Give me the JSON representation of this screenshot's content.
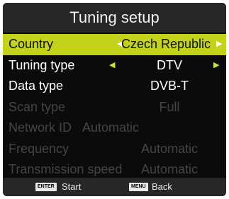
{
  "title": "Tuning setup",
  "rows": [
    {
      "label": "Country",
      "value": "Czech Republic",
      "arrow_left": "◀",
      "arrow_right": "▶"
    },
    {
      "label": "Tuning type",
      "value": "DTV",
      "arrow_left": "◀",
      "arrow_right": "▶"
    },
    {
      "label": "Data type",
      "value": "DVB-T"
    },
    {
      "label": "Scan type",
      "value": "Full"
    },
    {
      "label": "Network ID",
      "value": "Automatic"
    },
    {
      "label": "Frequency",
      "value": "Automatic"
    },
    {
      "label": "Transmission speed",
      "value": "Automatic"
    }
  ],
  "footer": {
    "enter_key": "ENTER",
    "enter_label": "Start",
    "menu_key": "MENU",
    "menu_label": "Back"
  },
  "colors": {
    "highlight": "#c3d31b",
    "background": "#0b0b0b",
    "bar": "#272727",
    "disabled_text": "#444444"
  }
}
